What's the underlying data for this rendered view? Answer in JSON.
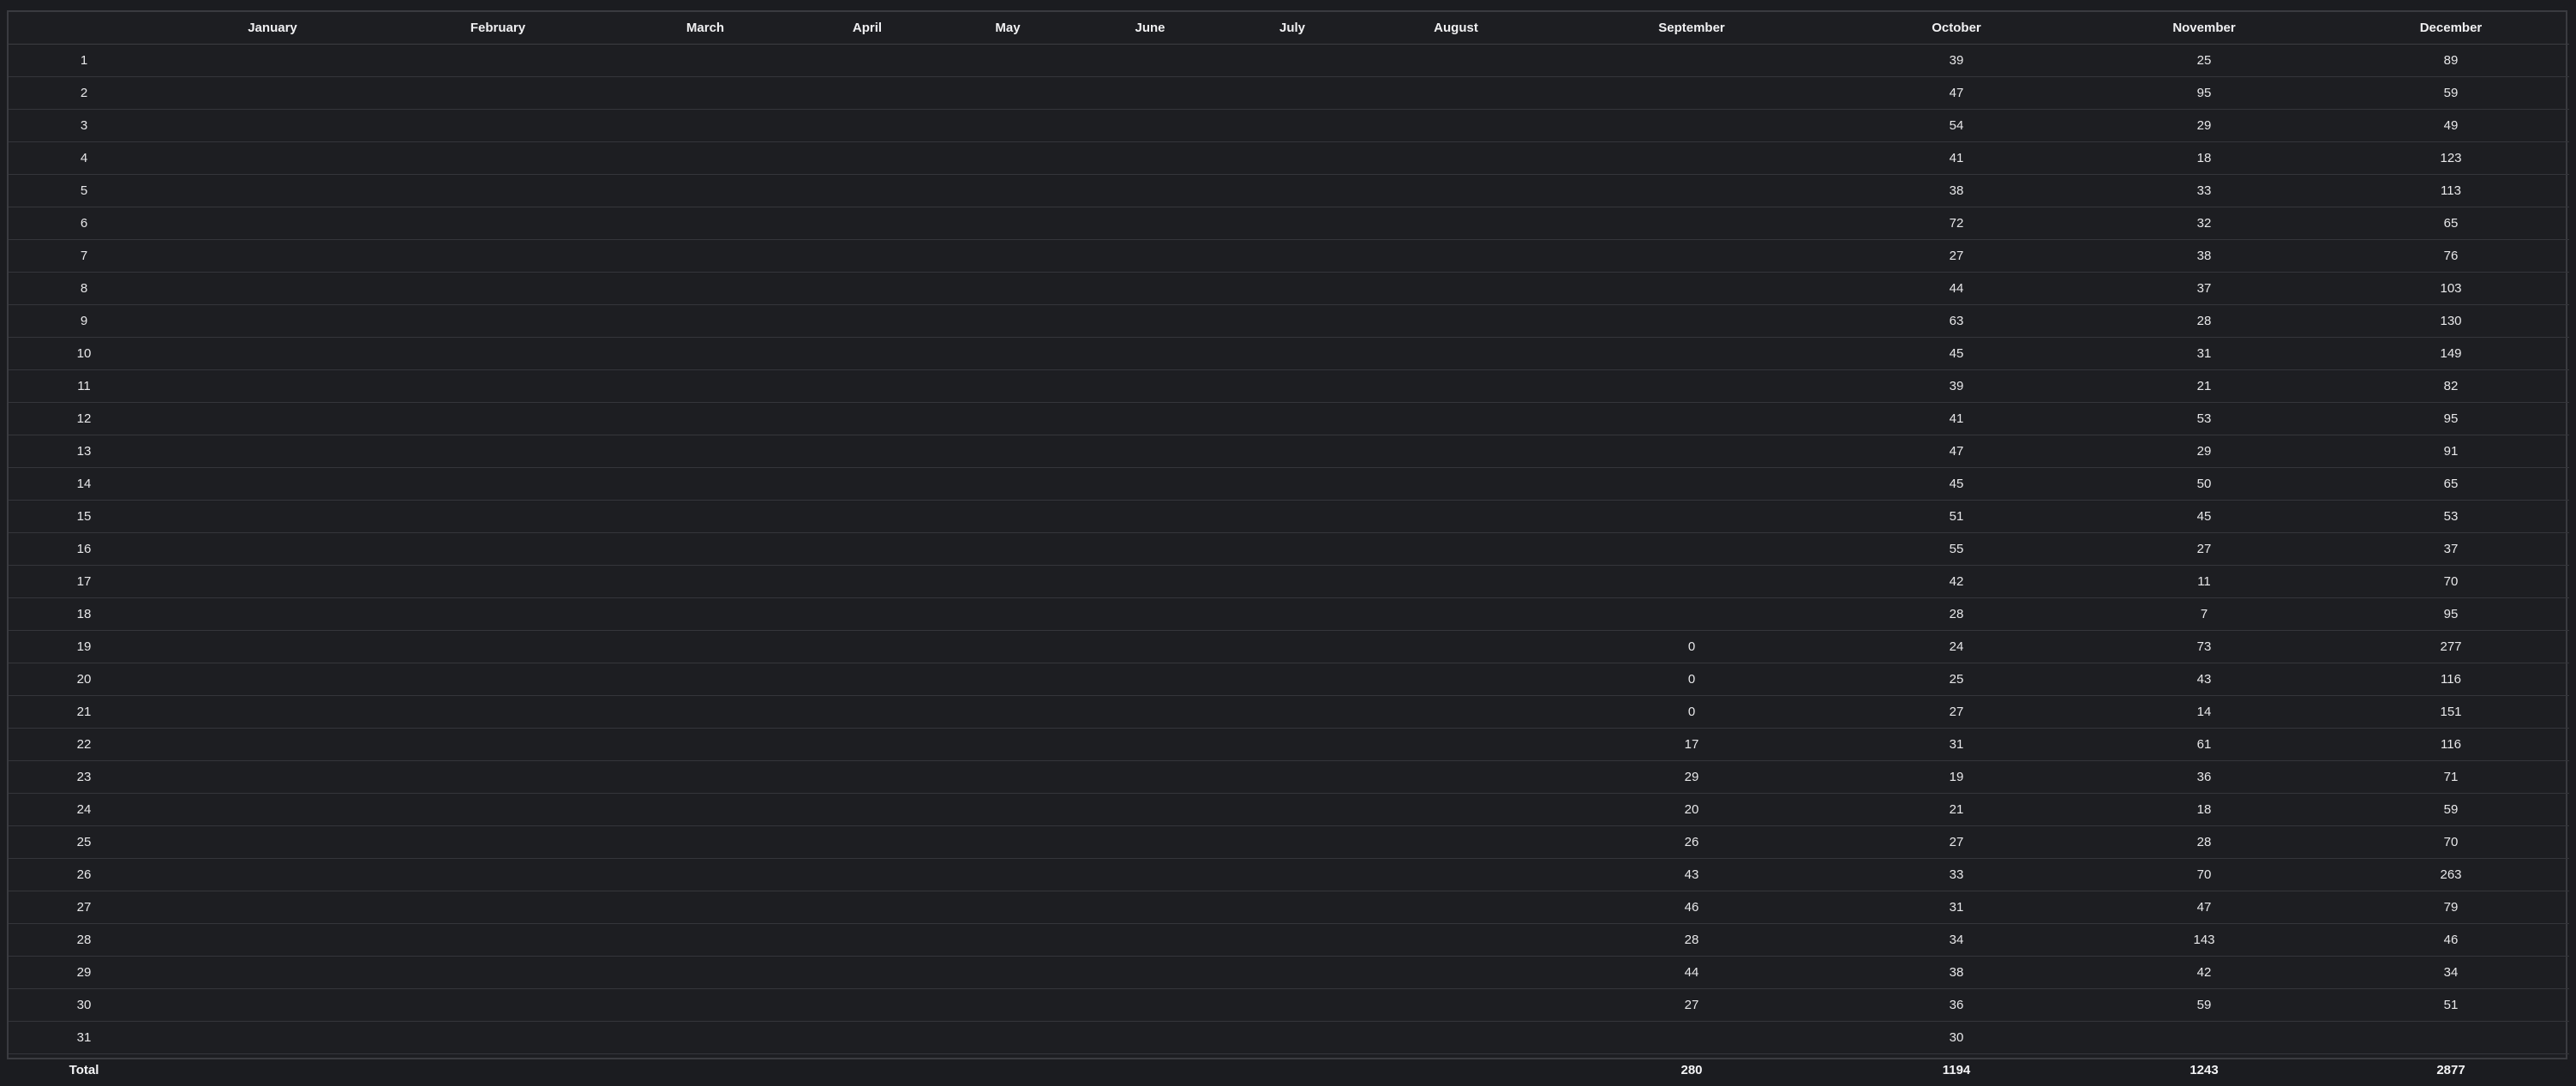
{
  "table": {
    "headers": [
      "",
      "January",
      "February",
      "March",
      "April",
      "May",
      "June",
      "July",
      "August",
      "September",
      "October",
      "November",
      "December"
    ],
    "rows": [
      [
        "1",
        "",
        "",
        "",
        "",
        "",
        "",
        "",
        "",
        "",
        "39",
        "25",
        "89"
      ],
      [
        "2",
        "",
        "",
        "",
        "",
        "",
        "",
        "",
        "",
        "",
        "47",
        "95",
        "59"
      ],
      [
        "3",
        "",
        "",
        "",
        "",
        "",
        "",
        "",
        "",
        "",
        "54",
        "29",
        "49"
      ],
      [
        "4",
        "",
        "",
        "",
        "",
        "",
        "",
        "",
        "",
        "",
        "41",
        "18",
        "123"
      ],
      [
        "5",
        "",
        "",
        "",
        "",
        "",
        "",
        "",
        "",
        "",
        "38",
        "33",
        "113"
      ],
      [
        "6",
        "",
        "",
        "",
        "",
        "",
        "",
        "",
        "",
        "",
        "72",
        "32",
        "65"
      ],
      [
        "7",
        "",
        "",
        "",
        "",
        "",
        "",
        "",
        "",
        "",
        "27",
        "38",
        "76"
      ],
      [
        "8",
        "",
        "",
        "",
        "",
        "",
        "",
        "",
        "",
        "",
        "44",
        "37",
        "103"
      ],
      [
        "9",
        "",
        "",
        "",
        "",
        "",
        "",
        "",
        "",
        "",
        "63",
        "28",
        "130"
      ],
      [
        "10",
        "",
        "",
        "",
        "",
        "",
        "",
        "",
        "",
        "",
        "45",
        "31",
        "149"
      ],
      [
        "11",
        "",
        "",
        "",
        "",
        "",
        "",
        "",
        "",
        "",
        "39",
        "21",
        "82"
      ],
      [
        "12",
        "",
        "",
        "",
        "",
        "",
        "",
        "",
        "",
        "",
        "41",
        "53",
        "95"
      ],
      [
        "13",
        "",
        "",
        "",
        "",
        "",
        "",
        "",
        "",
        "",
        "47",
        "29",
        "91"
      ],
      [
        "14",
        "",
        "",
        "",
        "",
        "",
        "",
        "",
        "",
        "",
        "45",
        "50",
        "65"
      ],
      [
        "15",
        "",
        "",
        "",
        "",
        "",
        "",
        "",
        "",
        "",
        "51",
        "45",
        "53"
      ],
      [
        "16",
        "",
        "",
        "",
        "",
        "",
        "",
        "",
        "",
        "",
        "55",
        "27",
        "37"
      ],
      [
        "17",
        "",
        "",
        "",
        "",
        "",
        "",
        "",
        "",
        "",
        "42",
        "11",
        "70"
      ],
      [
        "18",
        "",
        "",
        "",
        "",
        "",
        "",
        "",
        "",
        "",
        "28",
        "7",
        "95"
      ],
      [
        "19",
        "",
        "",
        "",
        "",
        "",
        "",
        "",
        "",
        "0",
        "24",
        "73",
        "277"
      ],
      [
        "20",
        "",
        "",
        "",
        "",
        "",
        "",
        "",
        "",
        "0",
        "25",
        "43",
        "116"
      ],
      [
        "21",
        "",
        "",
        "",
        "",
        "",
        "",
        "",
        "",
        "0",
        "27",
        "14",
        "151"
      ],
      [
        "22",
        "",
        "",
        "",
        "",
        "",
        "",
        "",
        "",
        "17",
        "31",
        "61",
        "116"
      ],
      [
        "23",
        "",
        "",
        "",
        "",
        "",
        "",
        "",
        "",
        "29",
        "19",
        "36",
        "71"
      ],
      [
        "24",
        "",
        "",
        "",
        "",
        "",
        "",
        "",
        "",
        "20",
        "21",
        "18",
        "59"
      ],
      [
        "25",
        "",
        "",
        "",
        "",
        "",
        "",
        "",
        "",
        "26",
        "27",
        "28",
        "70"
      ],
      [
        "26",
        "",
        "",
        "",
        "",
        "",
        "",
        "",
        "",
        "43",
        "33",
        "70",
        "263"
      ],
      [
        "27",
        "",
        "",
        "",
        "",
        "",
        "",
        "",
        "",
        "46",
        "31",
        "47",
        "79"
      ],
      [
        "28",
        "",
        "",
        "",
        "",
        "",
        "",
        "",
        "",
        "28",
        "34",
        "143",
        "46"
      ],
      [
        "29",
        "",
        "",
        "",
        "",
        "",
        "",
        "",
        "",
        "44",
        "38",
        "42",
        "34"
      ],
      [
        "30",
        "",
        "",
        "",
        "",
        "",
        "",
        "",
        "",
        "27",
        "36",
        "59",
        "51"
      ],
      [
        "31",
        "",
        "",
        "",
        "",
        "",
        "",
        "",
        "",
        "",
        "30",
        "",
        ""
      ]
    ],
    "total": [
      "Total",
      "",
      "",
      "",
      "",
      "",
      "",
      "",
      "",
      "280",
      "1194",
      "1243",
      "2877"
    ]
  },
  "colors": {
    "background": "#1b1c20",
    "surface": "#1d1e22",
    "border": "#3a3b40",
    "text": "#e8e8ea"
  }
}
